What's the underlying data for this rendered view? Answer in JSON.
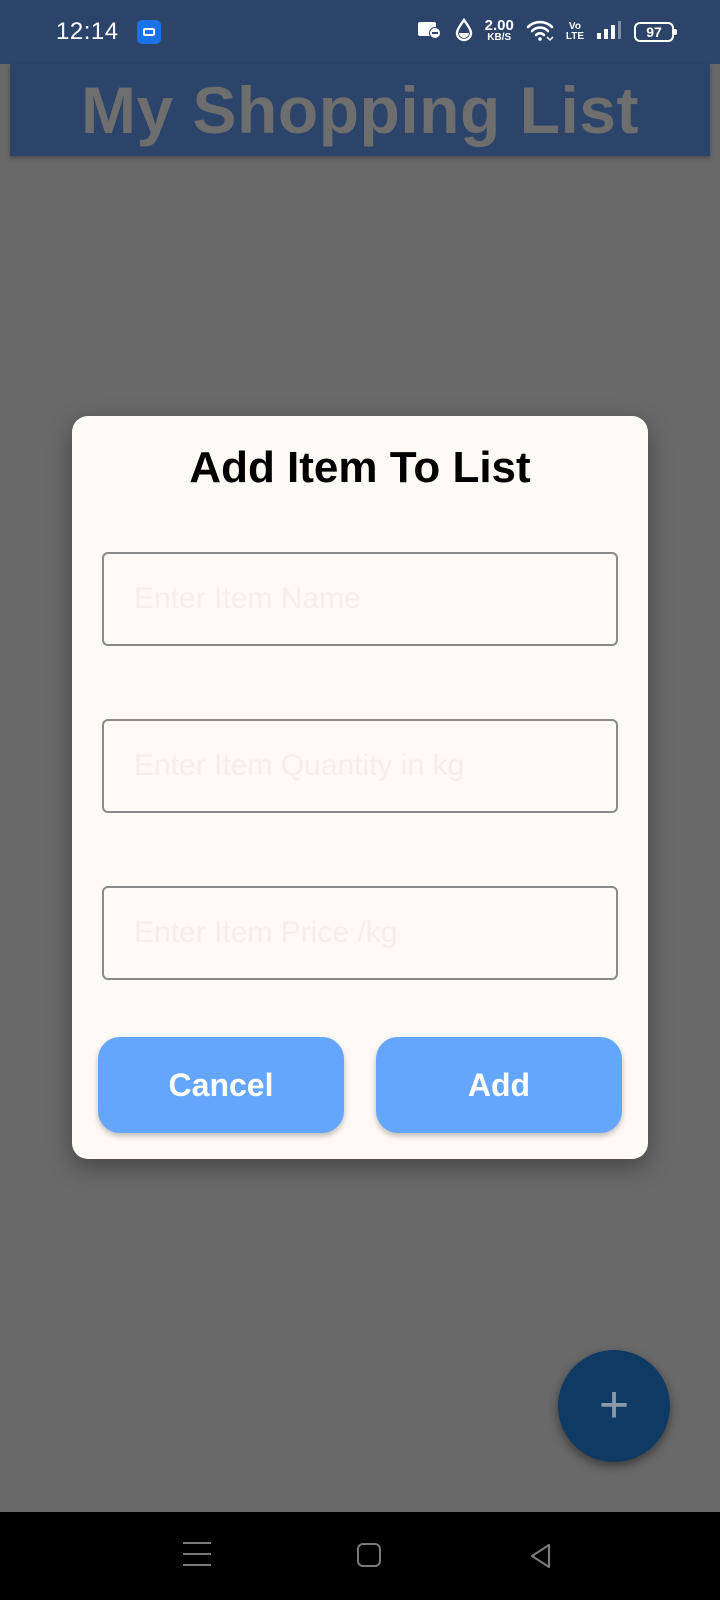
{
  "status_bar": {
    "time": "12:14",
    "net_speed_value": "2.00",
    "net_speed_unit": "KB/S",
    "volte_top": "Vo",
    "volte_bottom": "LTE",
    "battery": "97"
  },
  "app": {
    "title": "My Shopping List",
    "header_color": "#2c4469"
  },
  "dialog": {
    "title": "Add Item To List",
    "fields": {
      "name_placeholder": "Enter Item Name",
      "quantity_placeholder": "Enter Item Quantity in kg",
      "price_placeholder": "Enter Item Price /kg"
    },
    "cancel_label": "Cancel",
    "add_label": "Add",
    "button_color": "#64a6fb"
  },
  "fab": {
    "icon": "plus-icon",
    "label": "+"
  },
  "nav_bar": {
    "icons": [
      "menu-icon",
      "home-icon",
      "back-icon"
    ]
  }
}
